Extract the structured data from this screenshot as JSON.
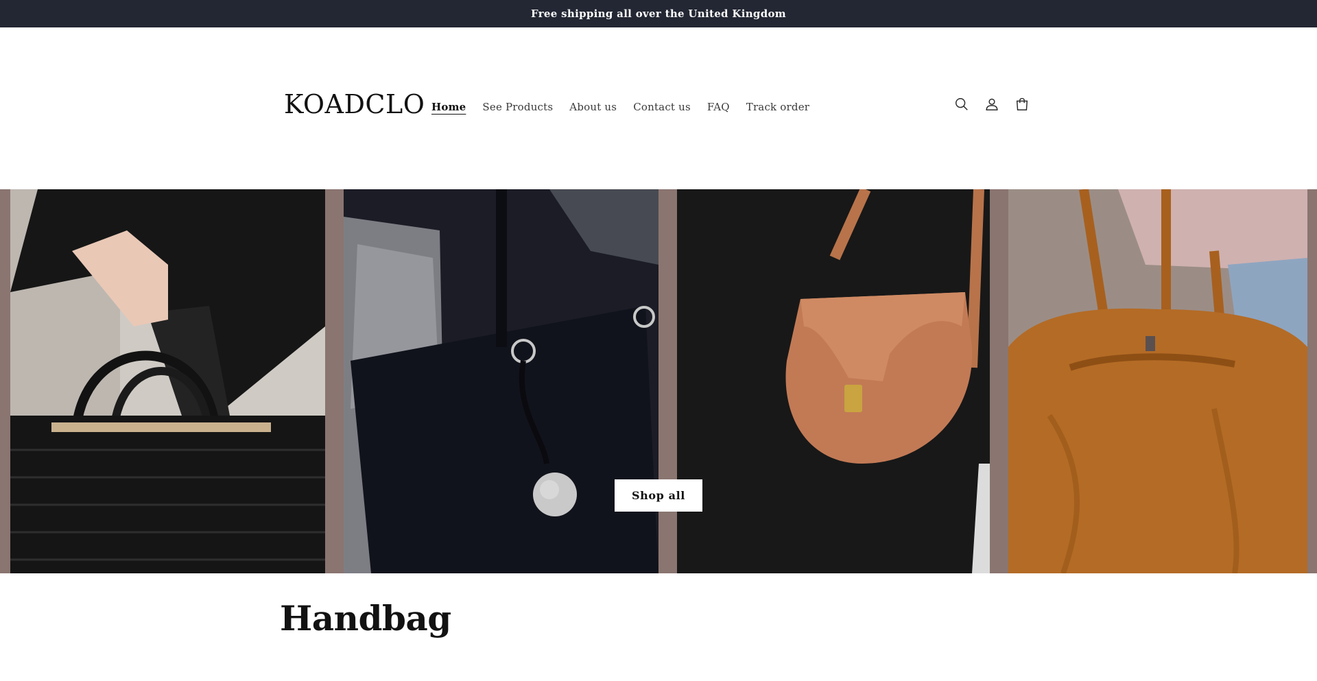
{
  "announcement": {
    "text": "Free shipping all over the United Kingdom"
  },
  "header": {
    "logo": "KOADCLO",
    "nav": [
      {
        "label": "Home",
        "active": true
      },
      {
        "label": "See Products",
        "active": false
      },
      {
        "label": "About us",
        "active": false
      },
      {
        "label": "Contact us",
        "active": false
      },
      {
        "label": "FAQ",
        "active": false
      },
      {
        "label": "Track order",
        "active": false
      }
    ],
    "icons": [
      "search-icon",
      "account-icon",
      "cart-icon"
    ]
  },
  "hero": {
    "button_label": "Shop all",
    "images": [
      "black-quilted-handbag",
      "navy-leather-tote",
      "tan-saddle-bag",
      "brown-suede-hobo-bag"
    ]
  },
  "section": {
    "title": "Handbag"
  },
  "colors": {
    "announcement_bg": "#232733",
    "hero_bg": "#8a7570",
    "text": "#121212"
  }
}
